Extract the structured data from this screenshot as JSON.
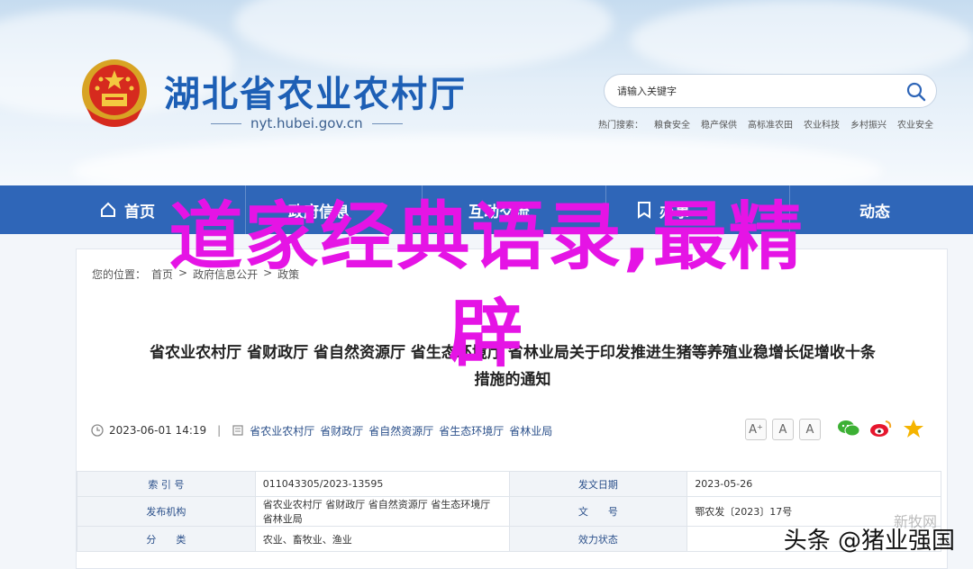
{
  "header": {
    "title": "湖北省农业农村厅",
    "domain": "nyt.hubei.gov.cn",
    "search_placeholder": "请输入关键字",
    "hot_label": "热门搜索：",
    "hot_items": [
      "粮食安全",
      "稳产保供",
      "高标准农田",
      "农业科技",
      "乡村振兴",
      "农业安全"
    ]
  },
  "nav": {
    "items": [
      "首页",
      "政府信息",
      "互动交流",
      "办事",
      "动态"
    ]
  },
  "breadcrumb": [
    "您的位置：",
    "首页",
    ">",
    "政府信息公开",
    ">",
    "政策"
  ],
  "article": {
    "title_line1": "省农业农村厅 省财政厅 省自然资源厅 省生态环境厅 省林业局关于印发推进生猪等养殖业稳增长促增收十条",
    "title_line2": "措施的通知",
    "date": "2023-06-01 14:19",
    "divider": "|",
    "orgs": [
      "省农业农村厅",
      "省财政厅",
      "省自然资源厅",
      "省生态环境厅",
      "省林业局"
    ],
    "font_buttons": [
      "A⁺",
      "A",
      "A"
    ]
  },
  "info_table": [
    [
      "索 引 号",
      "011043305/2023-13595",
      "发文日期",
      "2023-05-26"
    ],
    [
      "发布机构",
      "省农业农村厅 省财政厅 省自然资源厅 省生态环境厅 省林业局",
      "文　　号",
      "鄂农发〔2023〕17号"
    ],
    [
      "分　　类",
      "农业、畜牧业、渔业",
      "效力状态",
      ""
    ]
  ],
  "overlay": {
    "line1": "道家经典语录,最精",
    "line2": "辟"
  },
  "watermark": {
    "faint": "新牧网",
    "text": "头条 @猪业强国"
  },
  "colors": {
    "nav_bg": "#2f66b8",
    "title_blue": "#1d5fb5",
    "overlay": "#e514e5"
  }
}
